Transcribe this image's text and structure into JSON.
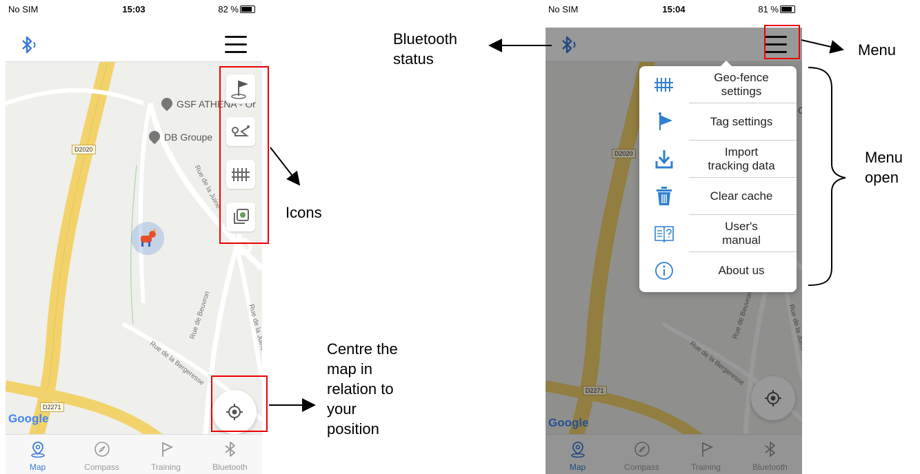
{
  "left_phone": {
    "status": {
      "carrier": "No SIM",
      "time": "15:03",
      "battery": "82 %"
    },
    "map": {
      "poi_1": "GSF ATHENA - Or",
      "poi_2": "DB Groupe",
      "road_1": "D2020",
      "road_2": "D2271",
      "street_1": "Rue de la Juine",
      "street_2": "Rue de Beuvron",
      "street_3": "Rue de la Bergeresse",
      "street_4": "Rue de la Juine",
      "google": "Google"
    }
  },
  "right_phone": {
    "status": {
      "carrier": "No SIM",
      "time": "15:04",
      "battery": "81 %"
    },
    "map": {
      "poi_partial": "Or",
      "road_1": "D2020",
      "road_2": "D2271",
      "street_1": "Rue de Beuvron",
      "street_2": "Rue de la Juine",
      "street_3": "Rue de la Bergeresse",
      "google": "Google"
    },
    "menu": [
      {
        "label": "Geo-fence\nsettings",
        "icon": "fence-icon"
      },
      {
        "label": "Tag settings",
        "icon": "flag-icon"
      },
      {
        "label": "Import\ntracking data",
        "icon": "download-icon"
      },
      {
        "label": "Clear cache",
        "icon": "trash-icon"
      },
      {
        "label": "User's\nmanual",
        "icon": "manual-icon"
      },
      {
        "label": "About us",
        "icon": "info-icon"
      }
    ]
  },
  "tabs": [
    {
      "label": "Map",
      "icon": "map-pin-icon",
      "active": true
    },
    {
      "label": "Compass",
      "icon": "compass-icon",
      "active": false
    },
    {
      "label": "Training",
      "icon": "flag-outline-icon",
      "active": false
    },
    {
      "label": "Bluetooth",
      "icon": "bluetooth-icon",
      "active": false
    }
  ],
  "callouts": {
    "bluetooth_status": "Bluetooth\nstatus",
    "menu": "Menu",
    "menu_open": "Menu\nopen",
    "icons": "Icons",
    "centre": "Centre the\nmap in\nrelation to\nyour\nposition"
  },
  "colors": {
    "accent": "#3a7bd5",
    "highlight_box": "#e00000",
    "road": "#f2d36b"
  }
}
